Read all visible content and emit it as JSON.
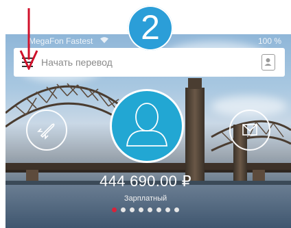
{
  "status_bar": {
    "carrier": "MegaFon Fastest",
    "right": "100 %"
  },
  "step_marker": "2",
  "search": {
    "placeholder": "Начать перевод"
  },
  "account": {
    "balance": "444 690.00 ₽",
    "name": "Зарплатный"
  },
  "pager": {
    "total": 8,
    "active": 1
  },
  "colors": {
    "accent": "#22a7d3",
    "marker": "#2b9ed8",
    "arrow": "#d0102a",
    "active_dot": "#d8233a"
  },
  "icons": [
    "menu-icon",
    "contact-card-icon",
    "rocket-icon",
    "envelope-icon",
    "user-icon",
    "wifi-icon",
    "red-arrow"
  ]
}
